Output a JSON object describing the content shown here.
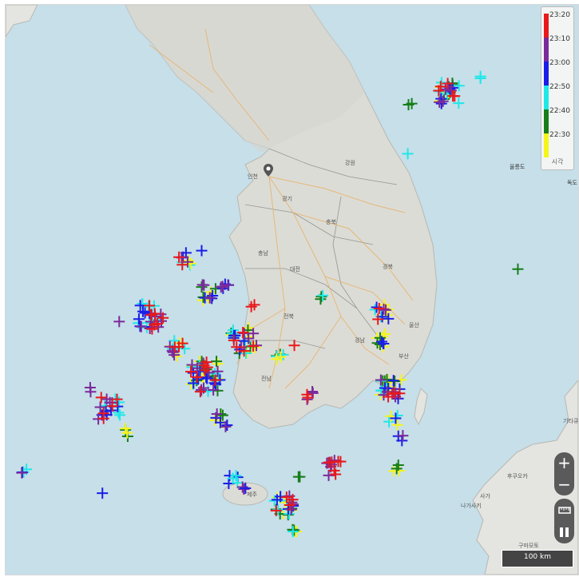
{
  "legend": {
    "entries": [
      {
        "time": "23:20",
        "color": "#e8181c"
      },
      {
        "time": "23:10",
        "color": "#7b2a9b"
      },
      {
        "time": "23:00",
        "color": "#1a1ee8"
      },
      {
        "time": "22:50",
        "color": "#1fe8e8"
      },
      {
        "time": "22:40",
        "color": "#177e1a"
      },
      {
        "time": "22:30",
        "color": "#f5f51a"
      }
    ],
    "footer": "시각"
  },
  "controls": {
    "zoom_in": "+",
    "zoom_out": "−"
  },
  "scale_bar": "100 km",
  "map_labels": {
    "incheon": "인천",
    "gyeonggi": "경기",
    "gangwon": "강원",
    "chungbuk": "충북",
    "chungnam": "충남",
    "daejeon": "대전",
    "gyeongbuk": "경북",
    "jeonbuk": "전북",
    "gyeongnam": "경남",
    "ulsan": "울산",
    "busan": "부산",
    "jeonnam": "전남",
    "jeju": "제주",
    "ulleungdo": "울릉도",
    "dokdo": "독도",
    "fukuoka": "후쿠오카",
    "saga": "사가",
    "nagasaki": "나가사키",
    "kitakyushu": "기타큐",
    "kumamoto": "구마모토"
  }
}
